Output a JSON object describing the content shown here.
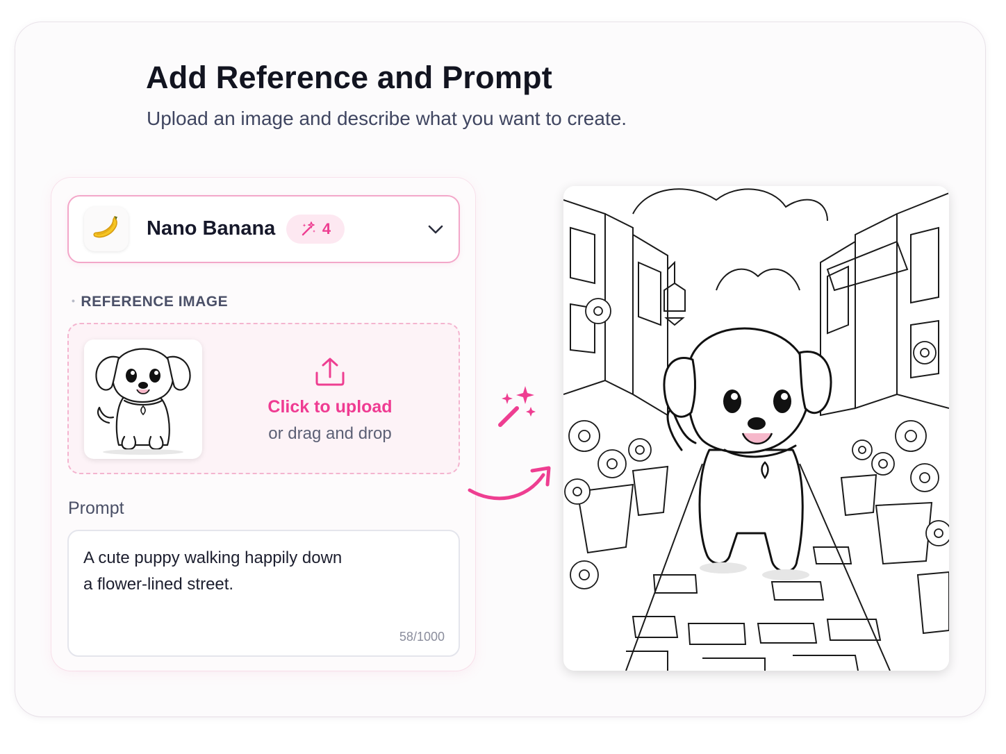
{
  "header": {
    "title": "Add Reference and Prompt",
    "subtitle": "Upload an image and describe what you want to create."
  },
  "model_selector": {
    "icon": "banana-icon",
    "name": "Nano Banana",
    "credits_icon": "magic-wand-icon",
    "credits": "4",
    "chevron": "chevron-down-icon"
  },
  "reference": {
    "label": "REFERENCE IMAGE",
    "thumbnail": "puppy-sketch-thumbnail",
    "upload_icon": "upload-icon",
    "upload_title": "Click to upload",
    "upload_sub": "or drag and drop"
  },
  "prompt": {
    "label": "Prompt",
    "value_line1": "A cute puppy walking happily down",
    "value_line2": "a flower-lined street.",
    "count": "58/1000"
  },
  "result": {
    "image": "puppy-flower-street-coloring-page",
    "sparkle_icon": "magic-wand-icon",
    "arrow_icon": "curved-arrow-icon"
  },
  "colors": {
    "accent": "#ef3b92",
    "accent_light": "#fde8f1",
    "border_pink": "#f3a7c9"
  }
}
